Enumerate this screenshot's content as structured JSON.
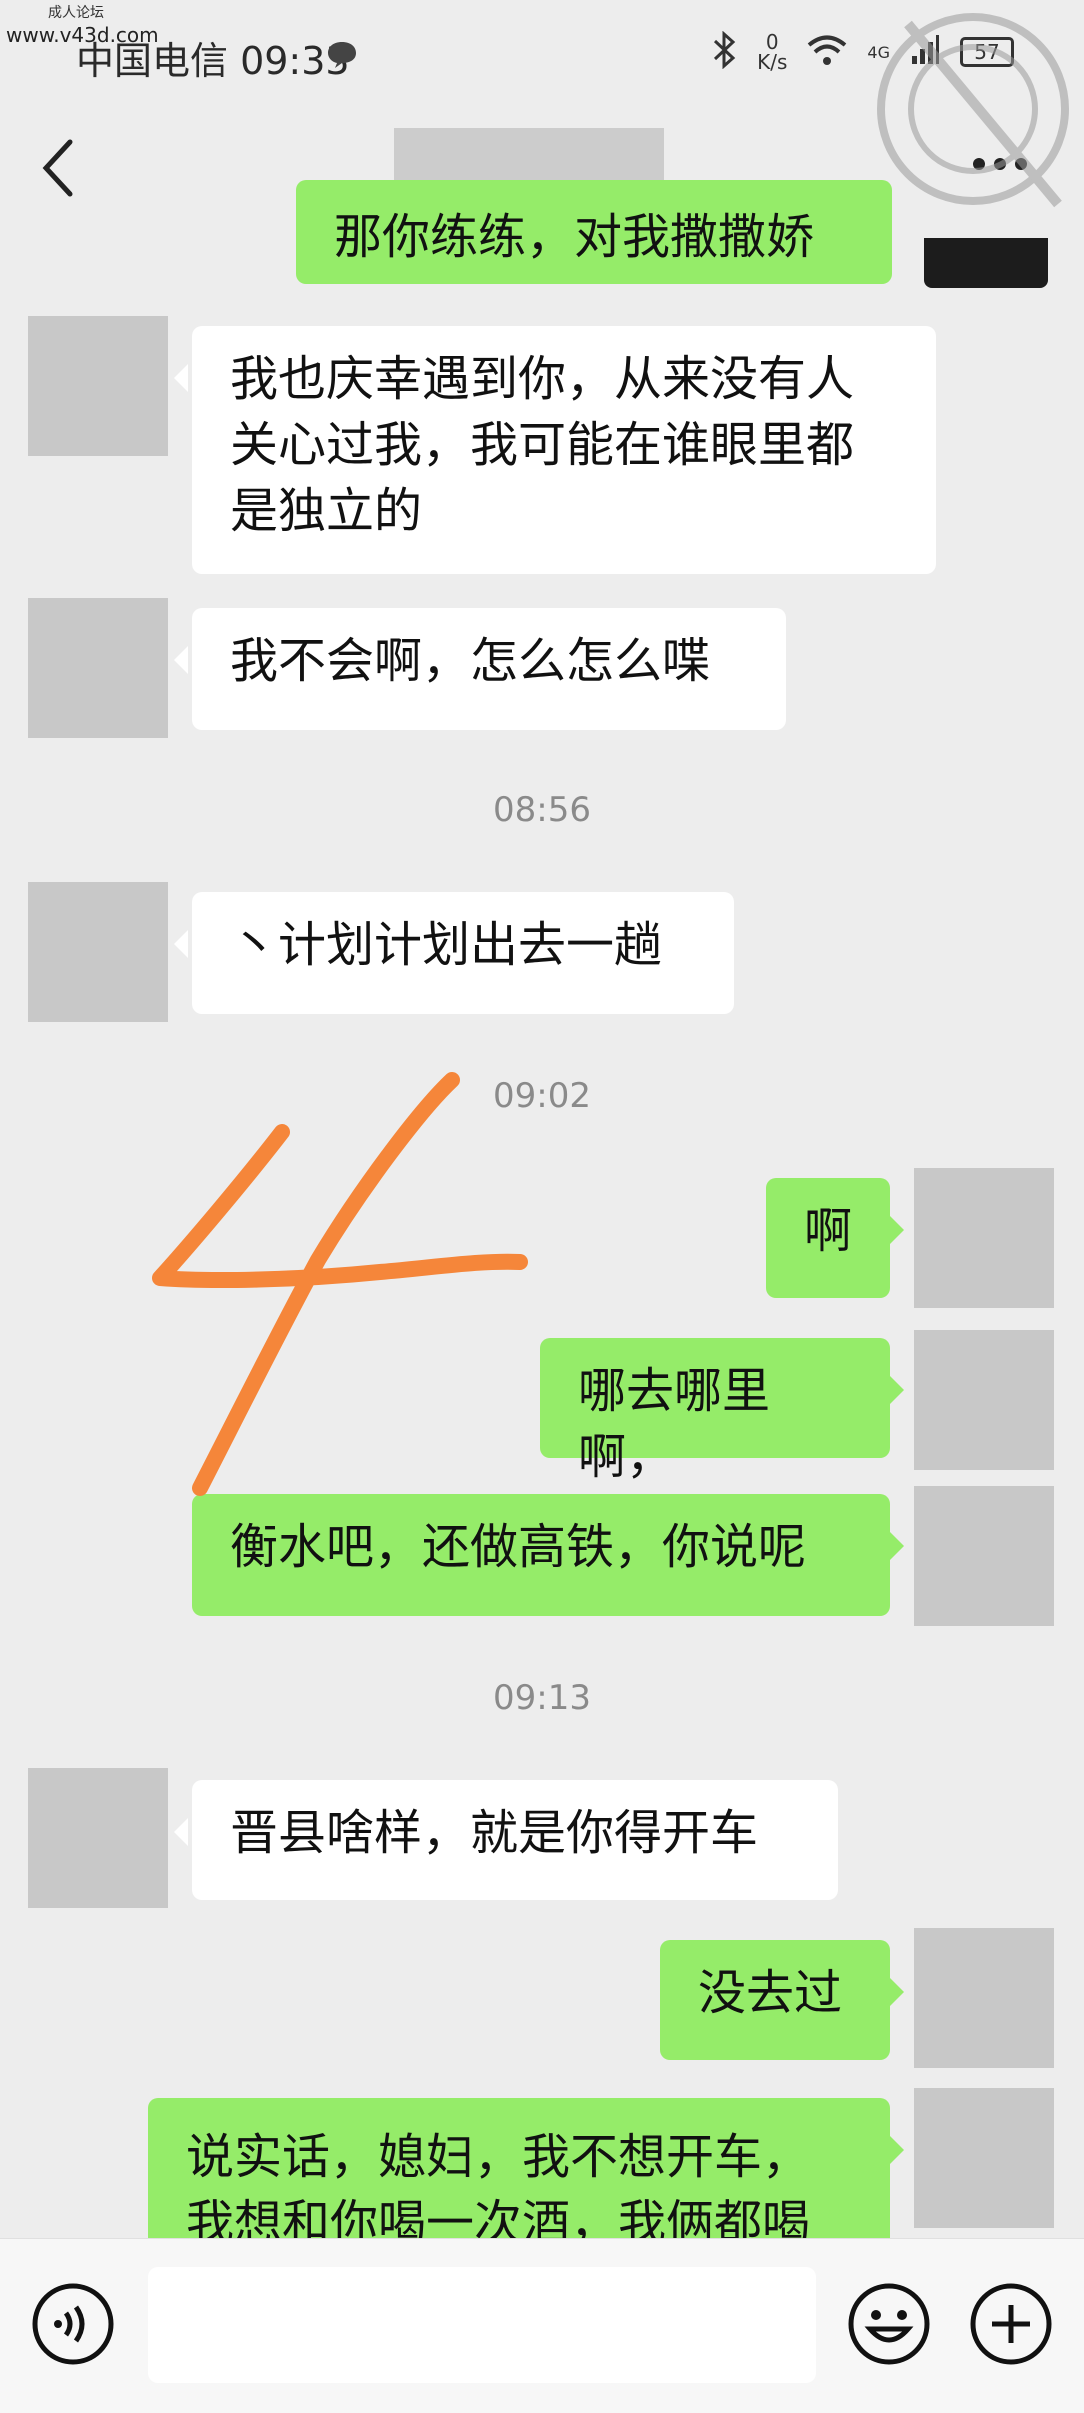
{
  "status_bar": {
    "watermark_small": "成人论坛",
    "watermark_url": "www.v43d.com",
    "carrier_time": "中国电信 09:33",
    "net_speed_value": "0",
    "net_speed_unit": "K/s",
    "network": "4G",
    "battery": "57"
  },
  "header": {
    "title": ""
  },
  "messages": [
    {
      "side": "right",
      "text": "那你练练，对我撒撒娇"
    },
    {
      "side": "left",
      "text": "我也庆幸遇到你，从来没有人关心过我，我可能在谁眼里都是独立的"
    },
    {
      "side": "left",
      "text": "我不会啊，怎么怎么喋"
    },
    {
      "time": "08:56"
    },
    {
      "side": "left",
      "text": "丶计划计划出去一趟"
    },
    {
      "time": "09:02"
    },
    {
      "side": "right",
      "text": "啊"
    },
    {
      "side": "right",
      "text": "哪去哪里啊，"
    },
    {
      "side": "right",
      "text": "衡水吧，还做高铁，你说呢"
    },
    {
      "time": "09:13"
    },
    {
      "side": "left",
      "text": "晋县啥样，就是你得开车"
    },
    {
      "side": "right",
      "text": "没去过"
    },
    {
      "side": "right",
      "text": "说实话，媳妇，我不想开车，我想和你喝一次酒，我俩都喝"
    }
  ],
  "input": {
    "placeholder": ""
  },
  "annotation": {
    "number": "4",
    "color": "#f5863a"
  },
  "colors": {
    "right_bubble": "#95ec69",
    "left_bubble": "#ffffff",
    "background": "#ededed"
  }
}
